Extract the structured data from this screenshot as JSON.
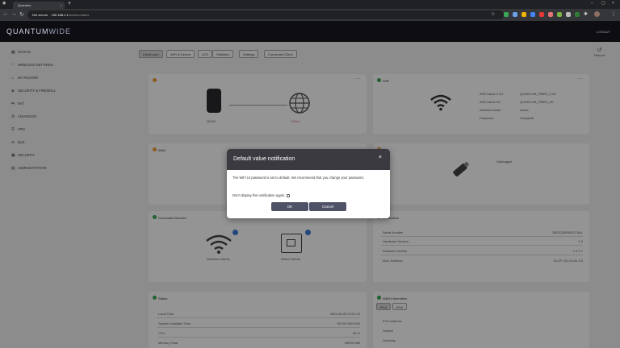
{
  "browser": {
    "tab_title": "Quantum",
    "secure_label": "Not secure",
    "url_host": "192.168.1.1",
    "url_path": "/#/index/status"
  },
  "app": {
    "logo_bold": "QUANTUM",
    "logo_light": "WIDE",
    "logout": "LOGOUT"
  },
  "sidebar": {
    "items": [
      {
        "label": "STATUS",
        "icon": "grid-icon"
      },
      {
        "label": "WIRELESS SETTINGS",
        "icon": "wifi-icon"
      },
      {
        "label": "MY ROUTER",
        "icon": "router-icon"
      },
      {
        "label": "SECURITY & FIREWALL",
        "icon": "shield-icon"
      },
      {
        "label": "NAT",
        "icon": "nat-icon"
      },
      {
        "label": "ADVANCED",
        "icon": "gear-icon"
      },
      {
        "label": "VPN",
        "icon": "vpn-icon"
      },
      {
        "label": "QoS",
        "icon": "qos-icon"
      },
      {
        "label": "SECURITY",
        "icon": "lock-icon"
      },
      {
        "label": "ADMINISTRATION",
        "icon": "admin-icon"
      }
    ]
  },
  "tabs": [
    "Dashboard",
    "WiFi & Device",
    "LED",
    "Statistics",
    "Settings",
    "Connected Client"
  ],
  "reboot": "Reboot",
  "cards": {
    "internet": {
      "left_label": "QUSH",
      "right_label": "Offline"
    },
    "wifi": {
      "title": "WiFi",
      "rows": [
        {
          "k": "WiFi Name 2.4G",
          "v": "QUANTUM_FIBER_2.4G"
        },
        {
          "k": "WiFi Name 5G",
          "v": "QUANTUM_FIBER_5G"
        },
        {
          "k": "Wireless Mode",
          "v": "Active"
        },
        {
          "k": "Password",
          "v": "Complete"
        }
      ]
    },
    "wan": {
      "title": "WAN"
    },
    "usb": {
      "title": "USB",
      "label": "Unplugged"
    },
    "clients": {
      "title": "Connected Devices",
      "wireless_label": "Wireless Clients",
      "wired_label": "Wired Clients"
    },
    "info": {
      "title": "Information",
      "rows": [
        {
          "k": "Serial Number",
          "v": "1BDCQ9F863CC4AL"
        },
        {
          "k": "Hardware Version",
          "v": "1.0"
        },
        {
          "k": "Software Version",
          "v": "1.0.7.7"
        },
        {
          "k": "MAC Address",
          "v": "34-EF-CB-C8-A1-E3"
        }
      ]
    },
    "status": {
      "title": "Status",
      "rows": [
        {
          "k": "Local Time",
          "v": "2024-05-28 13:51:10"
        },
        {
          "k": "System Available Time",
          "v": "0D 0H 26M 44S"
        },
        {
          "k": "CPU",
          "v": "35 %"
        },
        {
          "k": "Memory Total",
          "v": "495.82 MB"
        }
      ]
    },
    "wan_info": {
      "title": "WAN Information",
      "tabs": [
        "IPv4",
        "IPv6"
      ],
      "rows": [
        "IPv4 Address",
        "Subnet",
        "Gateway"
      ]
    }
  },
  "dialog": {
    "title": "Default value notification",
    "close": "×",
    "message": "The WiFi UI password is set to default. We recommend that you change your password.",
    "checkbox_label": "Don't display this notification again.",
    "ok": "OK",
    "cancel": "Cancel"
  }
}
